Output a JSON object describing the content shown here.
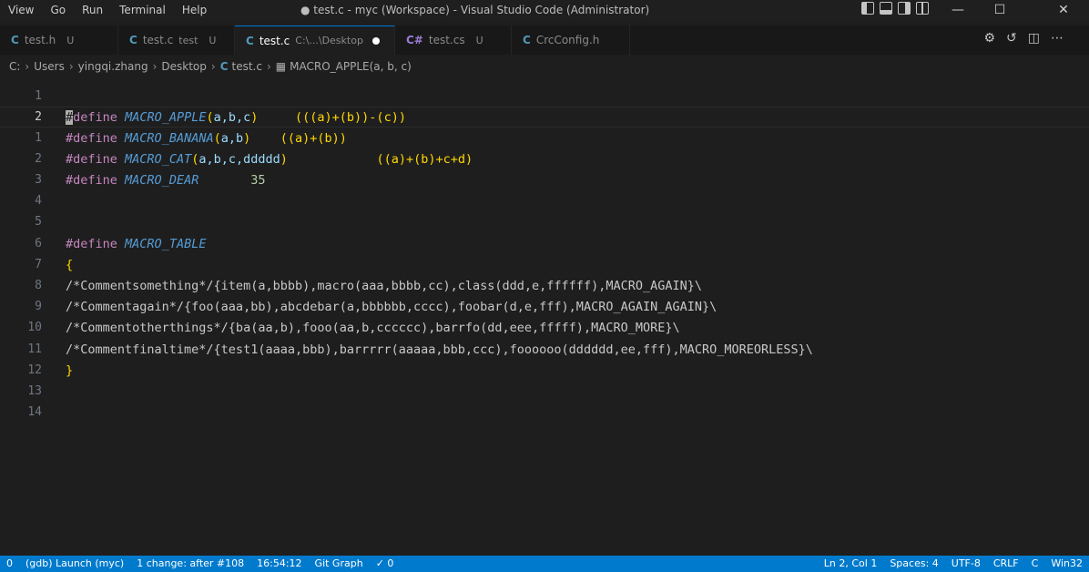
{
  "menu": [
    "View",
    "Go",
    "Run",
    "Terminal",
    "Help"
  ],
  "window_title": "● test.c - myc (Workspace) - Visual Studio Code (Administrator)",
  "window_controls": {
    "minimize": "—",
    "maximize": "☐",
    "close": "✕"
  },
  "tabs": [
    {
      "icon": "C",
      "name": "test.h",
      "desc": "",
      "mark": "U"
    },
    {
      "icon": "C",
      "name": "test.c",
      "desc": "test",
      "mark": "U"
    },
    {
      "icon": "C",
      "name": "test.c",
      "desc": "C:\\...\\Desktop",
      "mark": ""
    },
    {
      "icon": "C#",
      "name": "test.cs",
      "desc": "",
      "mark": "U"
    },
    {
      "icon": "C",
      "name": "CrcConfig.h",
      "desc": "",
      "mark": ""
    }
  ],
  "breadcrumb": [
    "C:",
    "Users",
    "yingqi.zhang",
    "Desktop",
    "test.c",
    "MACRO_APPLE(a, b, c)"
  ],
  "line_numbers": [
    "1",
    "2",
    "1",
    "2",
    "3",
    "4",
    "5",
    "6",
    "7",
    "8",
    "9",
    "10",
    "11",
    "12",
    "13",
    "14"
  ],
  "code": {
    "l2": {
      "kw": "define",
      "name": "MACRO_APPLE",
      "params": "a,b,c",
      "value": "(((a)+(b))-(c))"
    },
    "l3": {
      "kw": "#define",
      "name": "MACRO_BANANA",
      "params": "a,b",
      "value": "((a)+(b))"
    },
    "l4": {
      "kw": "#define",
      "name": "MACRO_CAT",
      "params": "a,b,c,ddddd",
      "value": "((a)+(b)+c+d)"
    },
    "l5": {
      "kw": "#define",
      "name": "MACRO_DEAR",
      "value": "35"
    },
    "l8": {
      "kw": "#define",
      "name": "MACRO_TABLE"
    },
    "l9": "{",
    "l10": "/*Commentsomething*/{item(a,bbbb),macro(aaa,bbbb,cc),class(ddd,e,ffffff),MACRO_AGAIN}\\",
    "l11": "/*Commentagain*/{foo(aaa,bb),abcdebar(a,bbbbbb,cccc),foobar(d,e,fff),MACRO_AGAIN_AGAIN}\\",
    "l12": "/*Commentotherthings*/{ba(aa,b),fooo(aa,b,cccccc),barrfo(dd,eee,fffff),MACRO_MORE}\\",
    "l13": "/*Commentfinaltime*/{test1(aaaa,bbb),barrrrr(aaaaa,bbb,ccc),foooooo(dddddd,ee,fff),MACRO_MOREORLESS}\\",
    "l14": "}"
  },
  "status": {
    "left": [
      "0",
      "(gdb) Launch (myc)",
      "1 change: after #108",
      "16:54:12",
      "Git Graph",
      "✓ 0"
    ],
    "right": [
      "Ln 2, Col 1",
      "Spaces: 4",
      "UTF-8",
      "CRLF",
      "C",
      "Win32"
    ]
  },
  "colors": {
    "accent": "#007acc",
    "editor_bg": "#1e1e1e"
  }
}
